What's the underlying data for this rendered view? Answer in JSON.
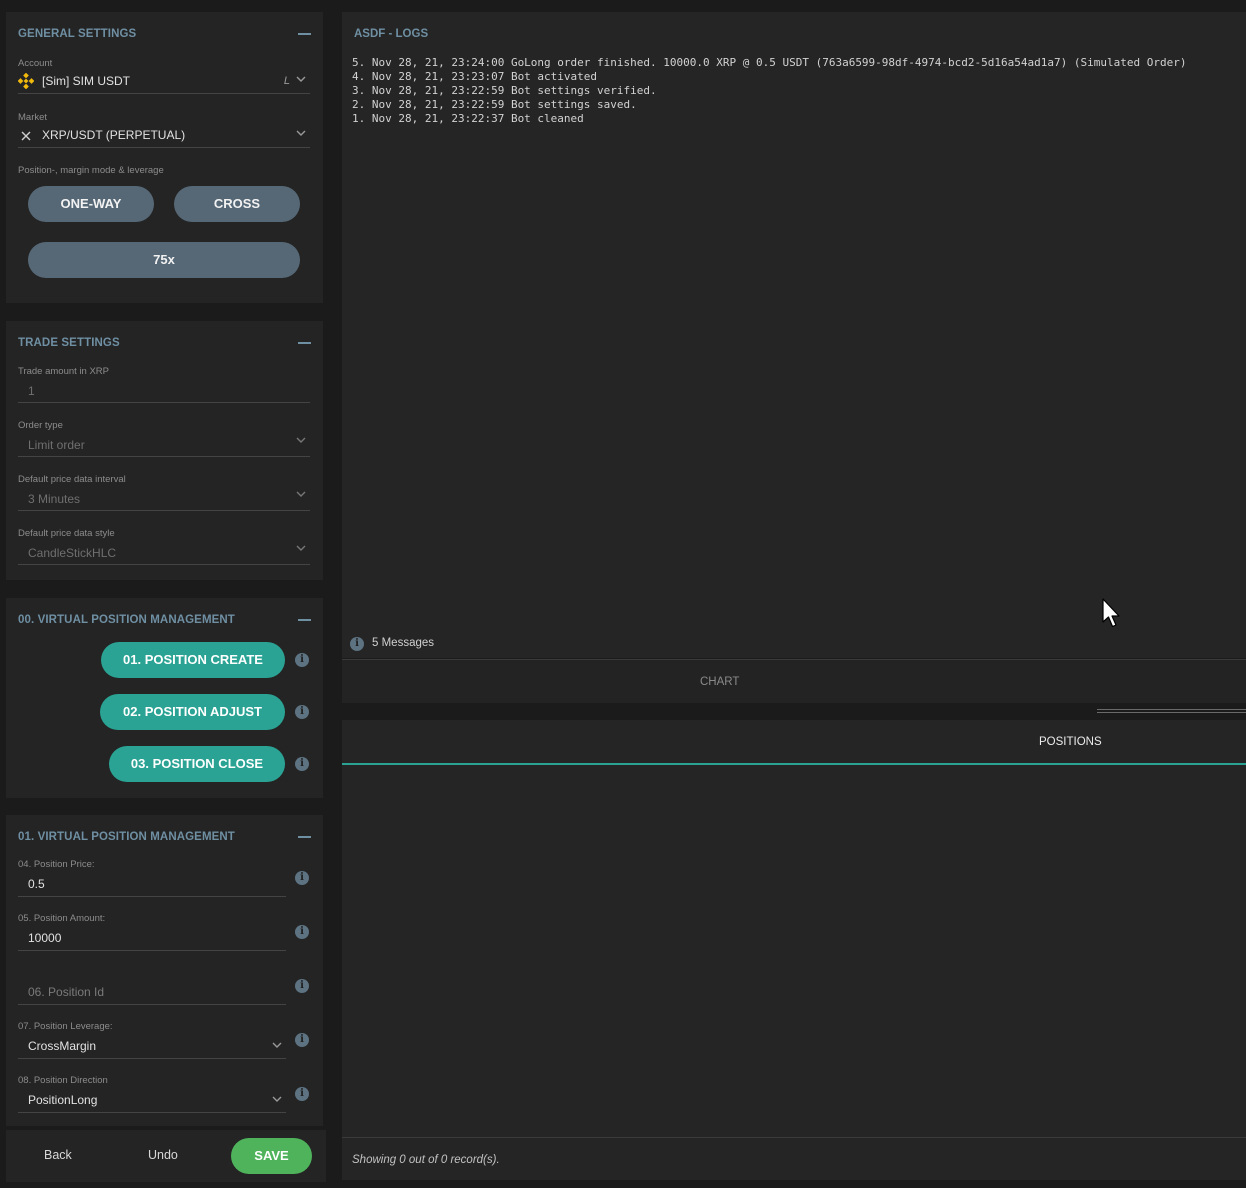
{
  "general": {
    "title": "GENERAL SETTINGS",
    "account_label": "Account",
    "account_value": "[Sim] SIM USDT",
    "account_flag": "L",
    "market_label": "Market",
    "market_value": "XRP/USDT (PERPETUAL)",
    "mode_label": "Position-, margin mode & leverage",
    "one_way": "ONE-WAY",
    "cross": "CROSS",
    "leverage": "75x"
  },
  "trade": {
    "title": "TRADE SETTINGS",
    "amount_label": "Trade amount in XRP",
    "amount_value": "1",
    "order_type_label": "Order type",
    "order_type_value": "Limit order",
    "interval_label": "Default price data interval",
    "interval_value": "3 Minutes",
    "style_label": "Default price data style",
    "style_value": "CandleStickHLC"
  },
  "vpm0": {
    "title": "00. VIRTUAL POSITION MANAGEMENT",
    "create": "01. POSITION CREATE",
    "adjust": "02. POSITION ADJUST",
    "close": "03. POSITION CLOSE"
  },
  "vpm1": {
    "title": "01. VIRTUAL POSITION MANAGEMENT",
    "price_label": "04. Position Price:",
    "price_value": "0.5",
    "amount_label": "05. Position Amount:",
    "amount_value": "10000",
    "id_placeholder": "06. Position Id",
    "leverage_label": "07. Position Leverage:",
    "leverage_value": "CrossMargin",
    "direction_label": "08. Position Direction",
    "direction_value": "PositionLong"
  },
  "actions": {
    "back": "Back",
    "undo": "Undo",
    "save": "SAVE"
  },
  "logs": {
    "title": "ASDF - LOGS",
    "lines": [
      "5. Nov 28, 21, 23:24:00 GoLong order finished. 10000.0 XRP @ 0.5 USDT (763a6599-98df-4974-bcd2-5d16a54ad1a7) (Simulated Order)",
      "4. Nov 28, 21, 23:23:07 Bot activated",
      "3. Nov 28, 21, 23:22:59 Bot settings verified.",
      "2. Nov 28, 21, 23:22:59 Bot settings saved.",
      "1. Nov 28, 21, 23:22:37 Bot cleaned"
    ],
    "message_count": "5 Messages"
  },
  "chart_tab": "CHART",
  "positions": {
    "tab": "POSITIONS",
    "footer": "Showing 0 out of 0 record(s)."
  },
  "icons": {
    "collapse": "minus-icon",
    "chevron": "chevron-down-icon",
    "info": "info-icon",
    "exchange": "binance-logo-icon",
    "market": "close-x-icon",
    "cursor": "mouse-pointer-icon"
  },
  "colors": {
    "background": "#1b1b1b",
    "panel": "#242424",
    "section_title": "#6f8fa3",
    "pill": "#566876",
    "teal": "#2aa394",
    "save": "#4fb35c",
    "binance": "#f0b90b"
  }
}
